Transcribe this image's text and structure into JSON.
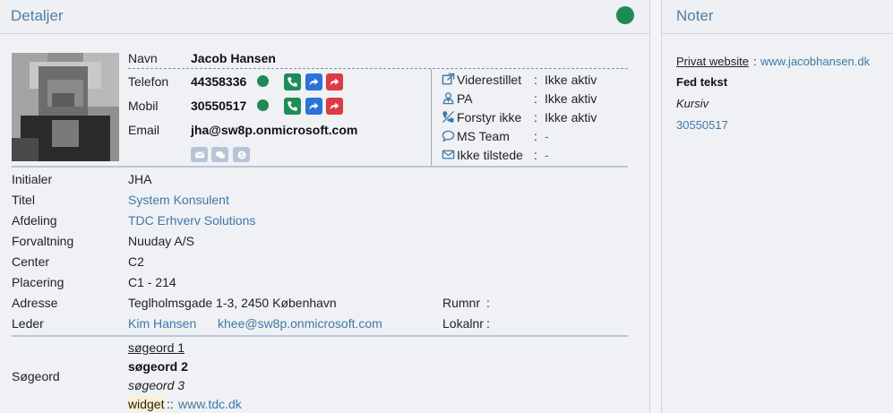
{
  "detaljer": {
    "title": "Detaljer",
    "presence_color": "#1f8a58",
    "navn_label": "Navn",
    "navn_value": "Jacob Hansen",
    "telefon_label": "Telefon",
    "telefon_value": "44358336",
    "mobil_label": "Mobil",
    "mobil_value": "30550517",
    "email_label": "Email",
    "email_value": "jha@sw8p.onmicrosoft.com",
    "status": [
      {
        "icon": "external-link-icon",
        "label": "Viderestillet",
        "sep": ":",
        "value": "Ikke aktiv"
      },
      {
        "icon": "pa-person-icon",
        "label": "PA",
        "sep": ":",
        "value": "Ikke aktiv"
      },
      {
        "icon": "phone-slash-icon",
        "label": "Forstyr ikke",
        "sep": ":",
        "value": "Ikke aktiv"
      },
      {
        "icon": "chat-bubble-icon",
        "label": "MS Team",
        "sep": ":",
        "value": "-"
      },
      {
        "icon": "envelope-icon",
        "label": "Ikke tilstede",
        "sep": ":",
        "value": "-"
      }
    ],
    "fields": {
      "initialer_label": "Initialer",
      "initialer_value": "JHA",
      "titel_label": "Titel",
      "titel_value": "System Konsulent",
      "afdeling_label": "Afdeling",
      "afdeling_value": "TDC Erhverv Solutions",
      "forvaltning_label": "Forvaltning",
      "forvaltning_value": "Nuuday A/S",
      "center_label": "Center",
      "center_value": "C2",
      "placering_label": "Placering",
      "placering_value": "C1 - 214",
      "adresse_label": "Adresse",
      "adresse_value": "Teglholmsgade 1-3, 2450 København",
      "rumnr_label": "Rumnr",
      "leder_label": "Leder",
      "leder_name": "Kim Hansen",
      "leder_email": "khee@sw8p.onmicrosoft.com",
      "lokalnr_label": "Lokalnr",
      "colon": ":"
    },
    "soegeord": {
      "label": "Søgeord",
      "line1": "søgeord 1",
      "line2": "søgeord 2",
      "line3": "søgeord 3",
      "widget_label": "widget",
      "widget_sep": "::",
      "widget_link": "www.tdc.dk"
    }
  },
  "noter": {
    "title": "Noter",
    "privat_label": "Privat website",
    "privat_sep": ":",
    "privat_link": "www.jacobhansen.dk",
    "fed": "Fed tekst",
    "kursiv": "Kursiv",
    "number": "30550517"
  }
}
